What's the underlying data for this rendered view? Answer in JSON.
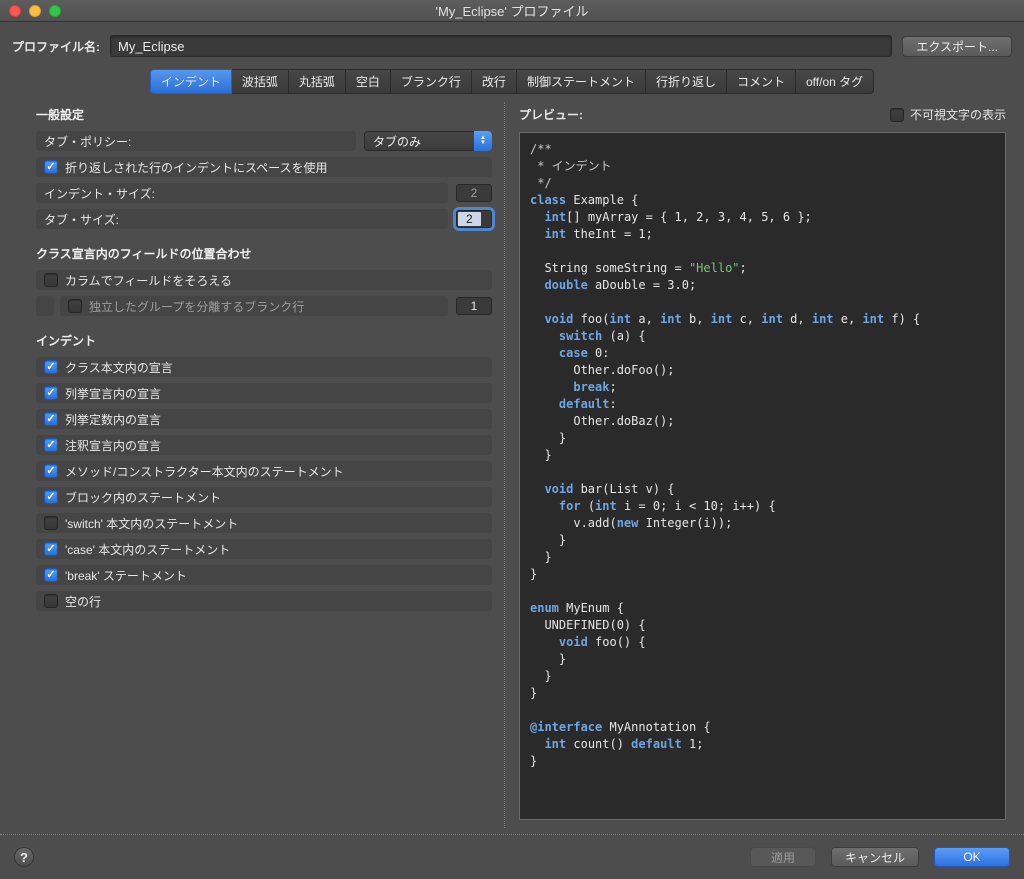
{
  "window": {
    "title": "'My_Eclipse' プロファイル"
  },
  "profile": {
    "label": "プロファイル名:",
    "value": "My_Eclipse",
    "export_button": "エクスポート..."
  },
  "tabs": {
    "active_index": 0,
    "labels": [
      "インデント",
      "波括弧",
      "丸括弧",
      "空白",
      "ブランク行",
      "改行",
      "制御ステートメント",
      "行折り返し",
      "コメント",
      "off/on タグ"
    ]
  },
  "general": {
    "title": "一般設定",
    "tab_policy_label": "タブ・ポリシー:",
    "tab_policy_value": "タブのみ",
    "wrapped_indent_label": "折り返しされた行のインデントにスペースを使用",
    "wrapped_indent_checked": true,
    "indent_size_label": "インデント・サイズ:",
    "indent_size_value": "2",
    "tab_size_label": "タブ・サイズ:",
    "tab_size_value": "2"
  },
  "field_alignment": {
    "title": "クラス宣言内のフィールドの位置合わせ",
    "align_columns_label": "カラムでフィールドをそろえる",
    "align_columns_checked": false,
    "blank_lines_label": "独立したグループを分離するブランク行",
    "blank_lines_checked": false,
    "blank_lines_value": "1"
  },
  "indent_section": {
    "title": "インデント",
    "items": [
      {
        "label": "クラス本文内の宣言",
        "checked": true
      },
      {
        "label": "列挙宣言内の宣言",
        "checked": true
      },
      {
        "label": "列挙定数内の宣言",
        "checked": true
      },
      {
        "label": "注釈宣言内の宣言",
        "checked": true
      },
      {
        "label": "メソッド/コンストラクター本文内のステートメント",
        "checked": true
      },
      {
        "label": "ブロック内のステートメント",
        "checked": true
      },
      {
        "label": "'switch' 本文内のステートメント",
        "checked": false
      },
      {
        "label": "'case' 本文内のステートメント",
        "checked": true
      },
      {
        "label": "'break' ステートメント",
        "checked": true
      },
      {
        "label": "空の行",
        "checked": false
      }
    ]
  },
  "preview": {
    "label": "プレビュー:",
    "whitespace_label": "不可視文字の表示",
    "whitespace_checked": false,
    "code": [
      [
        [
          "c",
          "/**"
        ]
      ],
      [
        [
          "c",
          " * インデント"
        ]
      ],
      [
        [
          "c",
          " */"
        ]
      ],
      [
        [
          "k",
          "class"
        ],
        [
          "p",
          " Example {"
        ]
      ],
      [
        [
          "p",
          "  "
        ],
        [
          "k",
          "int"
        ],
        [
          "p",
          "[] myArray = { 1, 2, 3, 4, 5, 6 };"
        ]
      ],
      [
        [
          "p",
          "  "
        ],
        [
          "k",
          "int"
        ],
        [
          "p",
          " theInt = 1;"
        ]
      ],
      [],
      [
        [
          "p",
          "  String someString = "
        ],
        [
          "s",
          "\"Hello\""
        ],
        [
          "p",
          ";"
        ]
      ],
      [
        [
          "p",
          "  "
        ],
        [
          "k",
          "double"
        ],
        [
          "p",
          " aDouble = 3.0;"
        ]
      ],
      [],
      [
        [
          "p",
          "  "
        ],
        [
          "k",
          "void"
        ],
        [
          "p",
          " foo("
        ],
        [
          "k",
          "int"
        ],
        [
          "p",
          " a, "
        ],
        [
          "k",
          "int"
        ],
        [
          "p",
          " b, "
        ],
        [
          "k",
          "int"
        ],
        [
          "p",
          " c, "
        ],
        [
          "k",
          "int"
        ],
        [
          "p",
          " d, "
        ],
        [
          "k",
          "int"
        ],
        [
          "p",
          " e, "
        ],
        [
          "k",
          "int"
        ],
        [
          "p",
          " f) {"
        ]
      ],
      [
        [
          "p",
          "    "
        ],
        [
          "k",
          "switch"
        ],
        [
          "p",
          " (a) {"
        ]
      ],
      [
        [
          "p",
          "    "
        ],
        [
          "k",
          "case"
        ],
        [
          "p",
          " 0:"
        ]
      ],
      [
        [
          "p",
          "      Other.doFoo();"
        ]
      ],
      [
        [
          "p",
          "      "
        ],
        [
          "k",
          "break"
        ],
        [
          "p",
          ";"
        ]
      ],
      [
        [
          "p",
          "    "
        ],
        [
          "k",
          "default"
        ],
        [
          "p",
          ":"
        ]
      ],
      [
        [
          "p",
          "      Other.doBaz();"
        ]
      ],
      [
        [
          "p",
          "    }"
        ]
      ],
      [
        [
          "p",
          "  }"
        ]
      ],
      [],
      [
        [
          "p",
          "  "
        ],
        [
          "k",
          "void"
        ],
        [
          "p",
          " bar(List v) {"
        ]
      ],
      [
        [
          "p",
          "    "
        ],
        [
          "k",
          "for"
        ],
        [
          "p",
          " ("
        ],
        [
          "k",
          "int"
        ],
        [
          "p",
          " i = 0; i < 10; i++) {"
        ]
      ],
      [
        [
          "p",
          "      v.add("
        ],
        [
          "k",
          "new"
        ],
        [
          "p",
          " Integer(i));"
        ]
      ],
      [
        [
          "p",
          "    }"
        ]
      ],
      [
        [
          "p",
          "  }"
        ]
      ],
      [
        [
          "p",
          "}"
        ]
      ],
      [],
      [
        [
          "k",
          "enum"
        ],
        [
          "p",
          " MyEnum {"
        ]
      ],
      [
        [
          "p",
          "  UNDEFINED(0) {"
        ]
      ],
      [
        [
          "p",
          "    "
        ],
        [
          "k",
          "void"
        ],
        [
          "p",
          " foo() {"
        ]
      ],
      [
        [
          "p",
          "    }"
        ]
      ],
      [
        [
          "p",
          "  }"
        ]
      ],
      [
        [
          "p",
          "}"
        ]
      ],
      [],
      [
        [
          "k",
          "@interface"
        ],
        [
          "p",
          " MyAnnotation {"
        ]
      ],
      [
        [
          "p",
          "  "
        ],
        [
          "k",
          "int"
        ],
        [
          "p",
          " count() "
        ],
        [
          "k",
          "default"
        ],
        [
          "p",
          " 1;"
        ]
      ],
      [
        [
          "p",
          "}"
        ]
      ]
    ]
  },
  "buttons": {
    "apply": "適用",
    "cancel": "キャンセル",
    "ok": "OK"
  }
}
